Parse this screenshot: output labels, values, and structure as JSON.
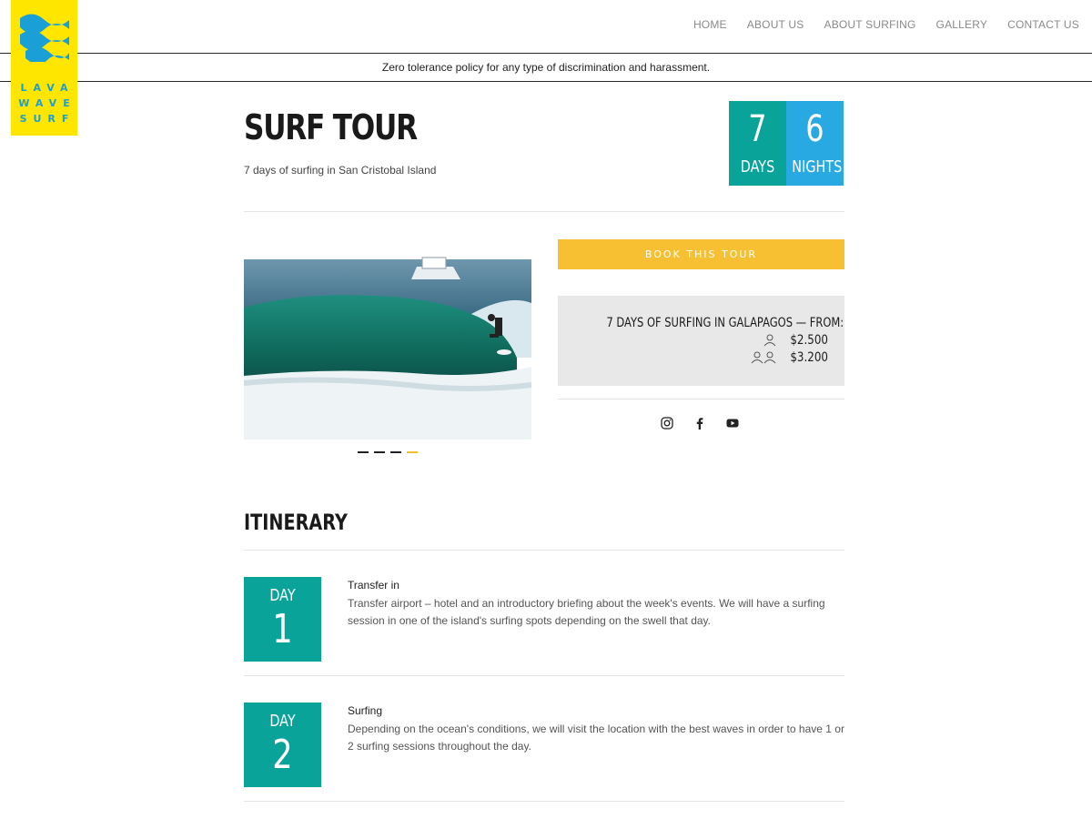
{
  "brand": {
    "line1": "LAVA",
    "line2": "WAVE",
    "line3": "SURF"
  },
  "nav": [
    "HOME",
    "ABOUT US",
    "ABOUT SURFING",
    "GALLERY",
    "CONTACT US"
  ],
  "notice": "Zero tolerance policy for any type of discrimination and harassment.",
  "tour": {
    "title": "SURF TOUR",
    "subtitle": "7 days of surfing in San Cristobal Island",
    "days_num": "7",
    "days_label": "DAYS",
    "nights_num": "6",
    "nights_label": "NIGHTS"
  },
  "booking": {
    "button": "BOOK THIS TOUR",
    "price_title": "7 DAYS OF SURFING IN GALAPAGOS — FROM:",
    "single_price": "$2.500",
    "double_price": "$3.200"
  },
  "social": [
    "instagram-icon",
    "facebook-icon",
    "youtube-icon"
  ],
  "itinerary": {
    "title": "ITINERARY",
    "days": [
      {
        "label": "DAY",
        "num": "1",
        "title": "Transfer in",
        "desc": "Transfer airport – hotel and an introductory briefing about the week's events. We will have a surfing session in one of the island's surfing spots depending on the swell that day."
      },
      {
        "label": "DAY",
        "num": "2",
        "title": "Surfing",
        "desc": "Depending on the ocean's conditions, we will visit the location with the best waves in order to have 1 or 2 surfing sessions throughout the day."
      }
    ]
  },
  "colors": {
    "teal": "#0aa39a",
    "blue": "#29a9e1",
    "yellow": "#f7c033",
    "logo_yellow": "#ffe600"
  }
}
